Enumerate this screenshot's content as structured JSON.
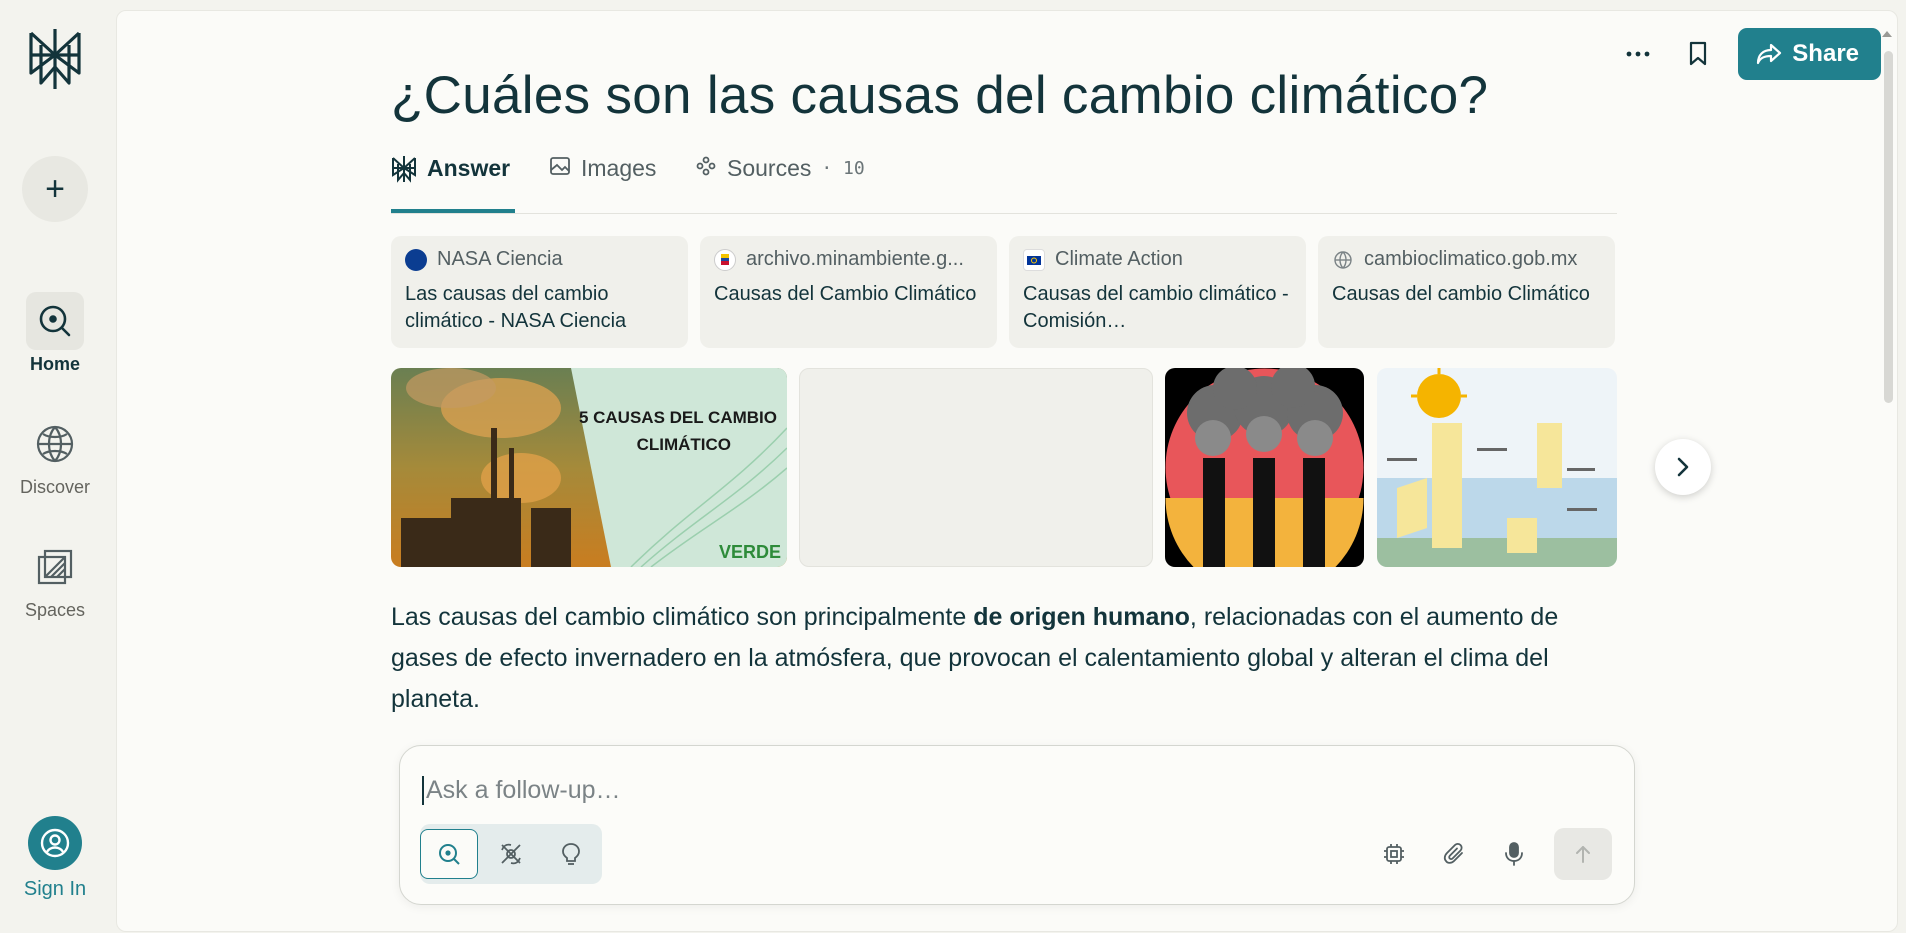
{
  "sidebar": {
    "new_thread_icon": "plus-icon",
    "items": [
      {
        "label": "Home",
        "icon": "search-circle-icon",
        "active": true
      },
      {
        "label": "Discover",
        "icon": "globe-icon",
        "active": false
      },
      {
        "label": "Spaces",
        "icon": "spaces-icon",
        "active": false
      }
    ],
    "sign_in": "Sign In"
  },
  "header": {
    "title": "¿Cuáles son las causas del cambio climático?",
    "more_icon": "ellipsis-icon",
    "bookmark_icon": "bookmark-icon",
    "share_label": "Share"
  },
  "tabs": [
    {
      "label": "Answer",
      "active": true
    },
    {
      "label": "Images",
      "active": false
    },
    {
      "label": "Sources",
      "count": "· 10",
      "active": false
    }
  ],
  "sources": [
    {
      "site": "NASA Ciencia",
      "title": "Las causas del cambio climático - NASA Ciencia"
    },
    {
      "site": "archivo.minambiente.g...",
      "title": "Causas del Cambio Climático"
    },
    {
      "site": "Climate Action",
      "title": "Causas del cambio climático - Comisión…"
    },
    {
      "site": "cambioclimatico.gob.mx",
      "title": "Causas del cambio Climático"
    }
  ],
  "images": {
    "image1_caption": "5 CAUSAS DEL CAMBIO CLIMÁTICO",
    "image1_logo": "VERDE"
  },
  "answer": {
    "before": "Las causas del cambio climático son principalmente ",
    "bold": "de origen humano",
    "after": ", relacionadas con el aumento de gases de efecto invernadero en la atmósfera, que provocan el calentamiento global y alteran el clima del planeta."
  },
  "followup": {
    "placeholder": "Ask a follow-up…"
  },
  "colors": {
    "accent": "#21808d",
    "text": "#13343b",
    "background": "#f3f3ee"
  }
}
